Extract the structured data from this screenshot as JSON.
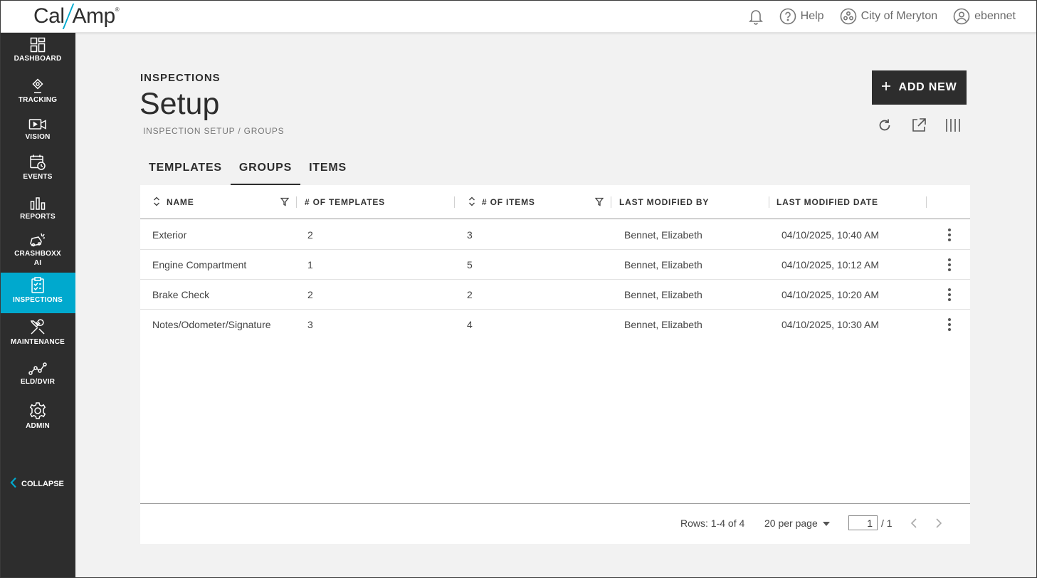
{
  "topbar": {
    "logo_left": "Cal",
    "logo_right": "Amp",
    "help_label": "Help",
    "org_label": "City of Meryton",
    "user_label": "ebennet"
  },
  "sidebar": {
    "items": [
      {
        "label": "DASHBOARD",
        "icon": "dashboard-icon"
      },
      {
        "label": "TRACKING",
        "icon": "location-pin-icon"
      },
      {
        "label": "VISION",
        "icon": "video-camera-icon"
      },
      {
        "label": "EVENTS",
        "icon": "calendar-clock-icon"
      },
      {
        "label": "REPORTS",
        "icon": "bar-chart-icon"
      },
      {
        "label": "CRASHBOXX",
        "label2": "AI",
        "icon": "crash-car-icon"
      },
      {
        "label": "INSPECTIONS",
        "icon": "clipboard-check-icon",
        "active": true
      },
      {
        "label": "MAINTENANCE",
        "icon": "wrench-screwdriver-icon"
      },
      {
        "label": "ELD/DVIR",
        "icon": "route-icon"
      },
      {
        "label": "ADMIN",
        "icon": "gear-icon"
      }
    ],
    "collapse_label": "COLLAPSE"
  },
  "header": {
    "section": "INSPECTIONS",
    "title": "Setup",
    "breadcrumb": "INSPECTION SETUP / GROUPS",
    "add_button": "ADD NEW"
  },
  "tabs": [
    {
      "label": "TEMPLATES",
      "active": false
    },
    {
      "label": "GROUPS",
      "active": true
    },
    {
      "label": "ITEMS",
      "active": false
    }
  ],
  "table": {
    "columns": [
      "NAME",
      "# OF TEMPLATES",
      "# OF ITEMS",
      "LAST MODIFIED BY",
      "LAST MODIFIED DATE"
    ],
    "rows": [
      {
        "name": "Exterior",
        "templates": "2",
        "items": "3",
        "modified_by": "Bennet, Elizabeth",
        "modified_date": "04/10/2025, 10:40 AM"
      },
      {
        "name": "Engine Compartment",
        "templates": "1",
        "items": "5",
        "modified_by": "Bennet, Elizabeth",
        "modified_date": "04/10/2025, 10:12 AM"
      },
      {
        "name": "Brake Check",
        "templates": "2",
        "items": "2",
        "modified_by": "Bennet, Elizabeth",
        "modified_date": "04/10/2025, 10:20 AM"
      },
      {
        "name": "Notes/Odometer/Signature",
        "templates": "3",
        "items": "4",
        "modified_by": "Bennet, Elizabeth",
        "modified_date": "04/10/2025, 10:30 AM"
      }
    ],
    "footer": {
      "rows_info": "Rows: 1-4 of 4",
      "per_page": "20 per page",
      "page_value": "1",
      "page_total": "/ 1"
    }
  },
  "colors": {
    "accent": "#00a9ce",
    "sidebar_bg": "#2d2d2d",
    "page_bg": "#f2f2f2"
  }
}
